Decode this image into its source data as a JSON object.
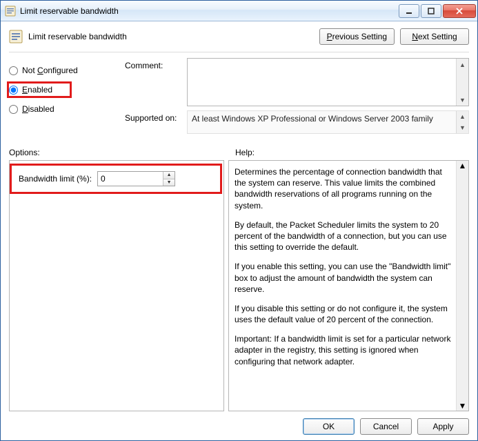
{
  "window": {
    "title": "Limit reservable bandwidth"
  },
  "header": {
    "title": "Limit reservable bandwidth",
    "prev": "Previous Setting",
    "next": "Next Setting"
  },
  "radios": {
    "not_configured": "Not Configured",
    "enabled": "Enabled",
    "disabled": "Disabled",
    "selected": "enabled"
  },
  "meta": {
    "comment_label": "Comment:",
    "comment_value": "",
    "supported_label": "Supported on:",
    "supported_value": "At least Windows XP Professional or Windows Server 2003 family"
  },
  "labels": {
    "options": "Options:",
    "help": "Help:"
  },
  "options": {
    "bandwidth_label": "Bandwidth limit (%):",
    "bandwidth_value": "0"
  },
  "help": {
    "p1": "Determines the percentage of connection bandwidth that the system can reserve. This value limits the combined bandwidth reservations of all programs running on the system.",
    "p2": "By default, the Packet Scheduler limits the system to 20 percent of the bandwidth of a connection, but you can use this setting to override the default.",
    "p3": "If you enable this setting, you can use the \"Bandwidth limit\" box to adjust the amount of bandwidth the system can reserve.",
    "p4": "If you disable this setting or do not configure it, the system uses the default value of 20 percent of the connection.",
    "p5": "Important: If a bandwidth limit is set for a particular network adapter in the registry, this setting is ignored when configuring that network adapter."
  },
  "footer": {
    "ok": "OK",
    "cancel": "Cancel",
    "apply": "Apply"
  }
}
